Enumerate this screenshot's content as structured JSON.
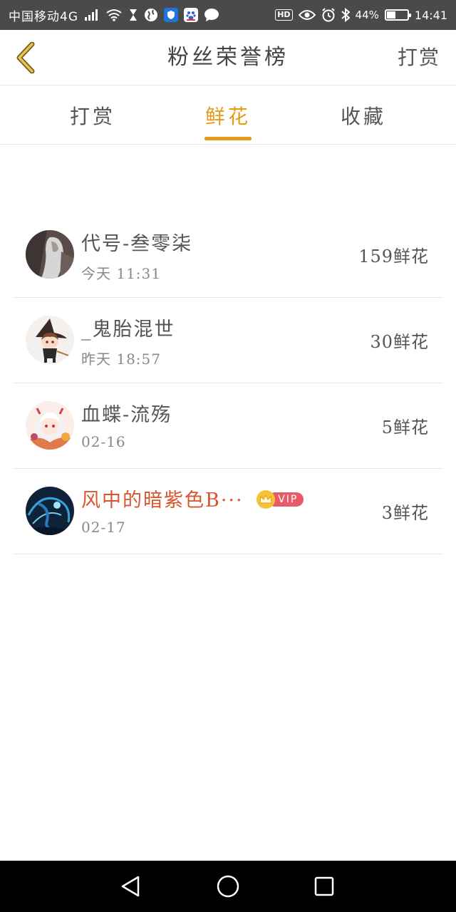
{
  "status_bar": {
    "carrier": "中国移动4G",
    "network": "4G",
    "battery": "44%",
    "battery_level": 0.44,
    "time": "14:41"
  },
  "header": {
    "title": "粉丝荣誉榜",
    "action_label": "打赏"
  },
  "tabs": [
    {
      "label": "打赏",
      "active": false
    },
    {
      "label": "鲜花",
      "active": true
    },
    {
      "label": "收藏",
      "active": false
    }
  ],
  "accent_color": "#e69b16",
  "vip_name_color": "#d9542f",
  "fans": [
    {
      "name": "代号-叁零柒",
      "time": "今天 11:31",
      "amount": "159鲜花",
      "vip": false
    },
    {
      "name": "_鬼胎混世",
      "time": "昨天 18:57",
      "amount": "30鲜花",
      "vip": false
    },
    {
      "name": "血蝶-流殇",
      "time": "02-16",
      "amount": "5鲜花",
      "vip": false
    },
    {
      "name": "风中的暗紫色B···",
      "time": "02-17",
      "amount": "3鲜花",
      "vip": true,
      "vip_label": "VIP"
    }
  ]
}
